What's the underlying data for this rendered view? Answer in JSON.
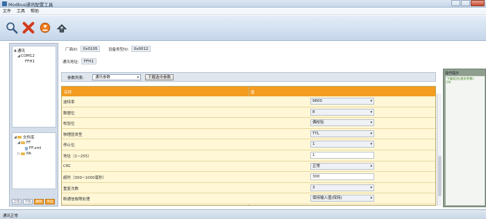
{
  "window": {
    "title": "Modbus通讯配置工具"
  },
  "menu": [
    "文件",
    "工具",
    "帮助"
  ],
  "toolbar": {
    "icons": [
      "search-icon",
      "close-icon",
      "download-icon",
      "connect-icon"
    ],
    "colors": {
      "close": "#d23a1c",
      "accent": "#f39c1f"
    }
  },
  "tree_top": {
    "items": [
      {
        "label": "通讯",
        "level": 0,
        "expander": "▲"
      },
      {
        "label": "COM12",
        "level": 1,
        "expander": "◢"
      },
      {
        "label": "FFH1",
        "level": 2,
        "expander": ""
      }
    ]
  },
  "tree_bottom": {
    "items": [
      {
        "label": "文件库",
        "level": 0,
        "expander": "◢",
        "type": "folder"
      },
      {
        "label": "FF",
        "level": 1,
        "expander": "◢",
        "type": "folder"
      },
      {
        "label": "FF.xml",
        "level": 2,
        "expander": "",
        "type": "file"
      },
      {
        "label": "PA",
        "level": 1,
        "expander": "▷",
        "type": "folder"
      }
    ]
  },
  "left_buttons": [
    "上位",
    "下位",
    "删除",
    "导出"
  ],
  "info": {
    "vendor_id_label": "厂商ID:",
    "vendor_id": "0x0105",
    "device_type_label": "设备类型ID:",
    "device_type": "0x0012",
    "address_label": "通讯地址:",
    "address": "FFH1"
  },
  "param_bar": {
    "label": "参数列表:",
    "selected": "通讯参数",
    "button": "下载选中参数"
  },
  "grid": {
    "col_name": "名称",
    "col_value": "值",
    "rows": [
      {
        "name": "波特率",
        "value": "9600",
        "kind": "select"
      },
      {
        "name": "数据位",
        "value": "8",
        "kind": "select"
      },
      {
        "name": "校验位",
        "value": "偶校验",
        "kind": "select"
      },
      {
        "name": "物理层类型",
        "value": "TTL",
        "kind": "select"
      },
      {
        "name": "停止位",
        "value": "1",
        "kind": "select"
      },
      {
        "name": "地址（1~255）",
        "value": "1",
        "kind": "input"
      },
      {
        "name": "CRC",
        "value": "正常",
        "kind": "select"
      },
      {
        "name": "超时（300~1000毫秒）",
        "value": "300",
        "kind": "input"
      },
      {
        "name": "重复次数",
        "value": "3",
        "kind": "select"
      },
      {
        "name": "断通信故障处理",
        "value": "保持输入值(保持)",
        "kind": "select"
      }
    ]
  },
  "right_panel": {
    "header": "操作提示",
    "lines": [
      "下载成功(通讯参数)",
      "OK"
    ]
  },
  "status": {
    "text": "通讯正常"
  }
}
